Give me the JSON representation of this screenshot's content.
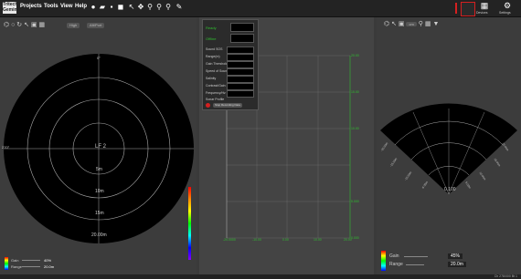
{
  "app": {
    "logo_lines": [
      "Tritech",
      "Gemini"
    ],
    "menu": [
      "Projects",
      "Tools",
      "View",
      "Help"
    ]
  },
  "toolbar_icons": [
    "record-icon",
    "folder-icon",
    "save-icon",
    "camera-icon",
    "video-icon",
    "pointer-icon",
    "move-icon",
    "zoom-icon",
    "zoom-in-icon",
    "zoom-out-icon",
    "pen-icon"
  ],
  "top_right": {
    "device_label": "Devices",
    "settings_label": "Settings"
  },
  "left_panel": {
    "toolbar_pills": [
      "High",
      "Aft/Port"
    ],
    "sonar": {
      "top_label": "0°",
      "left_label": "270°",
      "center_label": "LF 2",
      "range_labels": [
        "5m",
        "10m",
        "15m",
        "20.00m"
      ]
    },
    "gain_label": "Gain",
    "gain_value": "40%",
    "range_label": "Range",
    "range_value": "20.0m"
  },
  "mid_panel": {
    "overlay": {
      "status_label": "Ready",
      "mode_label": "Offline",
      "fields": [
        "Sound SOS",
        "Range(m)",
        "Gain Threshold",
        "Speed of Sound",
        "Salinity",
        "Contrast/Gain",
        "Frequency/Hz"
      ],
      "info_label": "Sonar Profile",
      "record_label": "Stop Recording Data"
    },
    "y_ticks": [
      "20.00",
      "15.00",
      "10.00",
      "5.000",
      "0.000"
    ],
    "x_ticks": [
      "-20.0000",
      "-10.00",
      "0.00",
      "10.00",
      "20.00"
    ]
  },
  "right_panel": {
    "pills": [
      "cm"
    ],
    "sector": {
      "center_label": "0.100",
      "left_labels": [
        "-20.00m",
        "-15.00m",
        "-10.00m",
        "-5.00m"
      ],
      "right_labels": [
        "5.00m",
        "10.00m",
        "15.00m",
        "20.00m"
      ]
    },
    "gain_label": "Gain",
    "gain_value": "45%",
    "range_label": "Range",
    "range_value": "20.0m"
  },
  "status_bar": {
    "text": "Ch 278/000 Bt 1"
  },
  "colors": {
    "accent_green": "#2fbf2f",
    "record_red": "#d42020",
    "background": "#3a3a3a"
  }
}
